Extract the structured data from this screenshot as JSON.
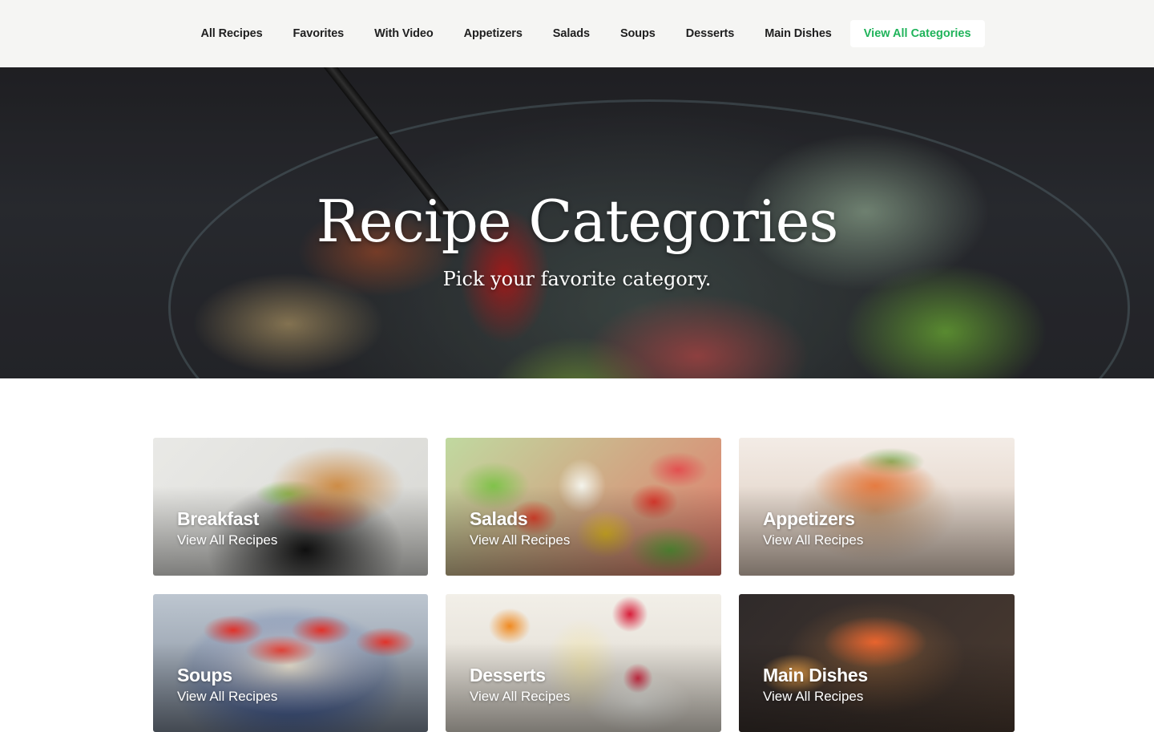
{
  "nav": {
    "items": [
      "All Recipes",
      "Favorites",
      "With Video",
      "Appetizers",
      "Salads",
      "Soups",
      "Desserts",
      "Main Dishes"
    ],
    "cta": "View All Categories"
  },
  "hero": {
    "title": "Recipe Categories",
    "subtitle": "Pick your favorite category."
  },
  "categories": [
    {
      "title": "Breakfast",
      "link": "View All Recipes"
    },
    {
      "title": "Salads",
      "link": "View All Recipes"
    },
    {
      "title": "Appetizers",
      "link": "View All Recipes"
    },
    {
      "title": "Soups",
      "link": "View All Recipes"
    },
    {
      "title": "Desserts",
      "link": "View All Recipes"
    },
    {
      "title": "Main Dishes",
      "link": "View All Recipes"
    }
  ],
  "colors": {
    "accent": "#1fb35a",
    "nav_bg": "#f5f5f3"
  }
}
